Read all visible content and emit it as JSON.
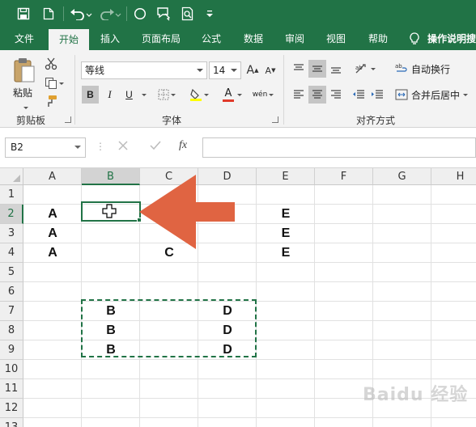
{
  "colors": {
    "brand": "#217346",
    "arrow": "#e06442",
    "selection_border": "#217346"
  },
  "quick_access": {
    "icons": [
      "save-icon",
      "new-file-icon",
      "undo-icon",
      "redo-icon",
      "shape-circle-icon",
      "touch-mode-icon",
      "print-preview-icon",
      "customize-icon"
    ]
  },
  "tabs": [
    {
      "label": "文件"
    },
    {
      "label": "开始",
      "active": true
    },
    {
      "label": "插入"
    },
    {
      "label": "页面布局"
    },
    {
      "label": "公式"
    },
    {
      "label": "数据"
    },
    {
      "label": "审阅"
    },
    {
      "label": "视图"
    },
    {
      "label": "帮助"
    }
  ],
  "tell_me": "操作说明搜",
  "ribbon": {
    "clipboard": {
      "paste_label": "粘贴",
      "group_label": "剪贴板"
    },
    "font": {
      "font_name": "等线",
      "font_size": "14",
      "bold": "B",
      "italic": "I",
      "underline": "U",
      "font_color_letter": "A",
      "phonetic": "wén",
      "grow_font": "A",
      "shrink_font": "A",
      "group_label": "字体"
    },
    "alignment": {
      "wrap_text": "自动换行",
      "merge_center": "合并后居中",
      "group_label": "对齐方式"
    }
  },
  "formula_bar": {
    "name_box": "B2",
    "fx_label": "fx",
    "formula": ""
  },
  "sheet": {
    "columns": [
      "A",
      "B",
      "C",
      "D",
      "E",
      "F",
      "G",
      "H"
    ],
    "selected_column": "B",
    "rows": [
      "1",
      "2",
      "3",
      "4",
      "5",
      "6",
      "7",
      "8",
      "9",
      "10",
      "11",
      "12",
      "13"
    ],
    "selected_row": "2",
    "active_cell": "B2",
    "copy_range": "B7:D9",
    "cells": {
      "A2": "A",
      "A3": "A",
      "A4": "A",
      "C4": "C",
      "E2": "E",
      "E3": "E",
      "E4": "E",
      "B7": "B",
      "B8": "B",
      "B9": "B",
      "D7": "D",
      "D8": "D",
      "D9": "D"
    }
  }
}
